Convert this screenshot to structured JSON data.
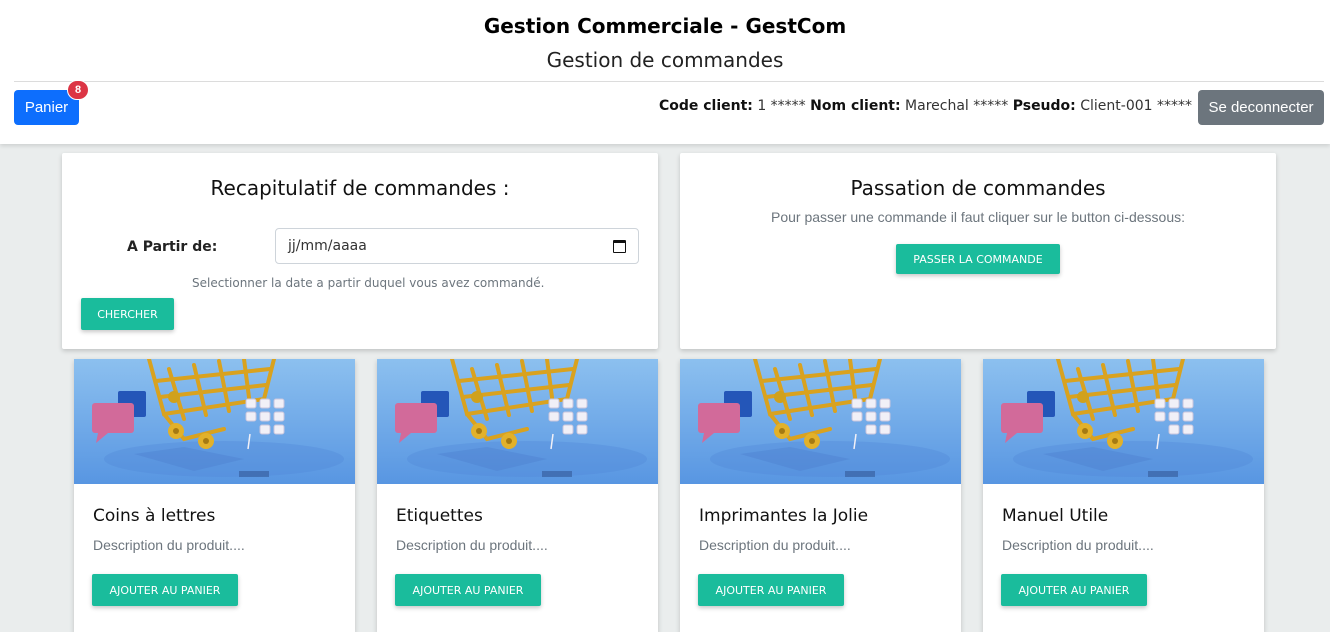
{
  "header": {
    "app_title": "Gestion Commerciale - GestCom",
    "page_subtitle": "Gestion de commandes",
    "cart_label": "Panier",
    "cart_count": "8",
    "client": {
      "code_label": "Code client:",
      "code_value": "1 *****",
      "name_label": "Nom client:",
      "name_value": "Marechal *****",
      "pseudo_label": "Pseudo:",
      "pseudo_value": "Client-001 *****"
    },
    "logout_label": "Se deconnecter"
  },
  "recap": {
    "title": "Recapitulatif de commandes :",
    "date_label": "A Partir de:",
    "date_placeholder": "jj/mm/aaaa",
    "help_text": "Selectionner la date a partir duquel vous avez commandé.",
    "search_label": "CHERCHER"
  },
  "order": {
    "title": "Passation de commandes",
    "info_text": "Pour passer une commande il faut cliquer sur le button ci-dessous:",
    "button_label": "PASSER LA COMMANDE"
  },
  "products": [
    {
      "name": "Coins à lettres",
      "description": "Description du produit....",
      "button_label": "AJOUTER AU PANIER"
    },
    {
      "name": "Etiquettes",
      "description": "Description du produit....",
      "button_label": "AJOUTER AU PANIER"
    },
    {
      "name": "Imprimantes la Jolie",
      "description": "Description du produit....",
      "button_label": "AJOUTER AU PANIER"
    },
    {
      "name": "Manuel Utile",
      "description": "Description du produit....",
      "button_label": "AJOUTER AU PANIER"
    }
  ],
  "colors": {
    "primary": "#0d6efd",
    "teal": "#1abc9c",
    "secondary": "#6c757d",
    "badge": "#dc3545",
    "background": "#eaeded"
  },
  "icons": {
    "date_picker": "calendar-icon",
    "product_image": "shopping-cart-image"
  }
}
